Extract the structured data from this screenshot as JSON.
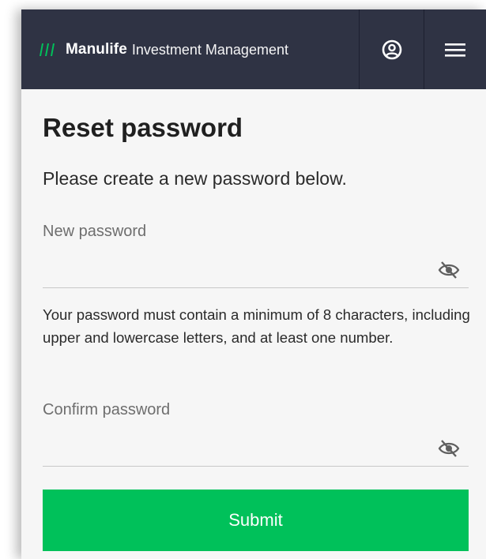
{
  "header": {
    "brand_name": "Manulife",
    "brand_sub": "Investment Management",
    "accent_color": "#00c15a",
    "background_color": "#2f3344",
    "profile_icon": "user-circle-icon",
    "menu_icon": "hamburger-menu-icon"
  },
  "page": {
    "title": "Reset password",
    "subtitle": "Please create a new password below."
  },
  "form": {
    "new_password": {
      "label": "New password",
      "value": "",
      "toggle_icon": "eye-off-icon"
    },
    "hint": "Your password must contain a minimum of 8 characters, including upper and lowercase letters, and at least one number.",
    "confirm_password": {
      "label": "Confirm password",
      "value": "",
      "toggle_icon": "eye-off-icon"
    },
    "submit_label": "Submit"
  }
}
